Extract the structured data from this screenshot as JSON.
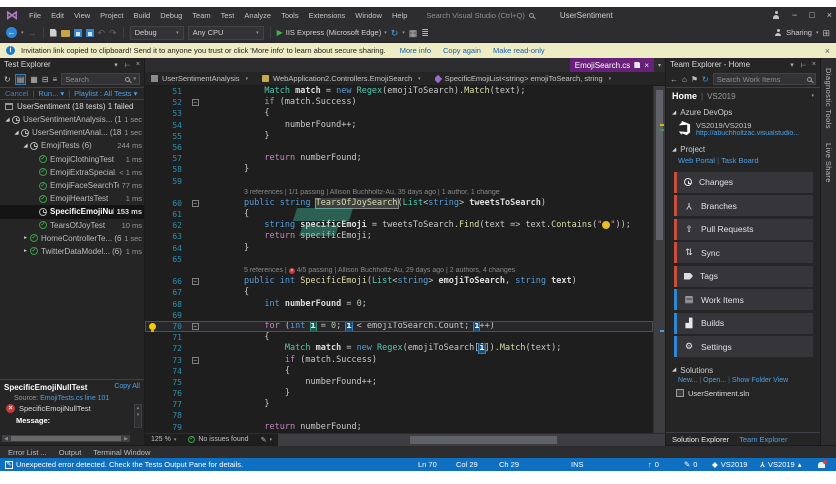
{
  "title_bar": {
    "menus": [
      "File",
      "Edit",
      "View",
      "Project",
      "Build",
      "Debug",
      "Team",
      "Test",
      "Analyze",
      "Tools",
      "Extensions",
      "Window",
      "Help"
    ],
    "search_placeholder": "Search Visual Studio (Ctrl+Q)",
    "title": "UserSentiment"
  },
  "toolbar": {
    "config": "Debug",
    "platform": "Any CPU",
    "run_target": "IIS Express (Microsoft Edge)",
    "sharing_label": "Sharing"
  },
  "infobar": {
    "message": "Invitation link copied to clipboard! Send it to anyone you trust or click 'More info' to learn about secure sharing.",
    "more_info": "More info",
    "copy_again": "Copy again",
    "make_read_only": "Make read-only"
  },
  "test_explorer": {
    "title": "Test Explorer",
    "search_placeholder": "Search",
    "cancel": "Cancel",
    "run": "Run...",
    "playlist": "Playlist : All Tests",
    "summary": "UserSentiment (18 tests) 1 failed",
    "tree": [
      {
        "indent": 0,
        "arrow": "exp",
        "icon": "clock",
        "label": "UserSentimentAnalysis... (10)",
        "time": "1 sec"
      },
      {
        "indent": 1,
        "arrow": "exp",
        "icon": "clock",
        "label": "UserSentimentAnal... (18)",
        "time": "1 sec"
      },
      {
        "indent": 2,
        "arrow": "exp",
        "icon": "clock",
        "label": "EmojiTests (6)",
        "time": "244 ms"
      },
      {
        "indent": 3,
        "icon": "pass",
        "label": "EmojiClothingTest",
        "time": "1 ms"
      },
      {
        "indent": 3,
        "icon": "pass",
        "label": "EmojiExtraSpecial...",
        "time": "< 1 ms"
      },
      {
        "indent": 3,
        "icon": "pass",
        "label": "EmojiFaceSearchTest",
        "time": "77 ms"
      },
      {
        "indent": 3,
        "icon": "pass",
        "label": "EmojiHeartsTest",
        "time": "1 ms"
      },
      {
        "indent": 3,
        "icon": "clock",
        "label": "SpecificEmojiNullT...",
        "time": "153 ms",
        "selected": true
      },
      {
        "indent": 3,
        "icon": "pass",
        "label": "TearsOfJoyTest",
        "time": "10 ms"
      },
      {
        "indent": 2,
        "arrow": "col",
        "icon": "pass",
        "label": "HomeControllerTe... (6)",
        "time": "1 sec"
      },
      {
        "indent": 2,
        "arrow": "col",
        "icon": "pass",
        "label": "TwitterDataModel... (6)",
        "time": "1 ms"
      }
    ],
    "details": {
      "title": "SpecificEmojiNullTest",
      "copy_all": "Copy All",
      "source_label": "Source:",
      "source_link": "EmojiTests.cs line 101",
      "result": "SpecificEmojiNullTest",
      "message_label": "Message:"
    }
  },
  "editor": {
    "tab": "EmojiSearch.cs",
    "nav": [
      "UserSentimentAnalysis",
      "WebApplication2.Controllers.EmojiSearch",
      "SpecificEmojiList<string> emojiToSearch, string"
    ],
    "zoom": "125 %",
    "issues": "No issues found",
    "lines": [
      {
        "n": 51,
        "t": [
          [
            "            "
          ],
          [
            "Match",
            "ty"
          ],
          [
            " "
          ],
          [
            "match",
            "v"
          ],
          [
            " = "
          ],
          [
            "new",
            "kw"
          ],
          [
            " "
          ],
          [
            "Regex",
            "ty"
          ],
          [
            "("
          ],
          [
            "emojiToSearch"
          ],
          [
            ")."
          ],
          [
            "Match",
            "m"
          ],
          [
            "("
          ],
          [
            "text"
          ],
          [
            ");"
          ]
        ]
      },
      {
        "n": 52,
        "fold": 1,
        "t": [
          [
            "            "
          ],
          [
            "if",
            "ctrl"
          ],
          [
            " ("
          ],
          [
            "match"
          ],
          [
            ".Success)"
          ]
        ]
      },
      {
        "n": 53,
        "t": [
          [
            "            {"
          ]
        ]
      },
      {
        "n": 54,
        "t": [
          [
            "                "
          ],
          [
            "numberFound"
          ],
          [
            "++;"
          ]
        ]
      },
      {
        "n": 55,
        "t": [
          [
            "            }"
          ]
        ]
      },
      {
        "n": 56,
        "t": []
      },
      {
        "n": 57,
        "t": [
          [
            "            "
          ],
          [
            "return",
            "ctrl"
          ],
          [
            " "
          ],
          [
            "numberFound"
          ],
          [
            ";"
          ]
        ]
      },
      {
        "n": 58,
        "t": [
          [
            "        }"
          ]
        ]
      },
      {
        "n": 59,
        "t": []
      },
      {
        "n": 60,
        "fold": 1,
        "lens": {
          "pre": "3 references | ",
          "post": "1/1 passing | Allison Buchholtz-Au, 35 days ago | 1 author, 1 change",
          "fail": false
        },
        "t": [
          [
            "        "
          ],
          [
            "public",
            "kw"
          ],
          [
            " "
          ],
          [
            "string",
            "kw"
          ],
          [
            " "
          ],
          [
            "TearsOfJoySearch",
            "mh"
          ],
          [
            "("
          ],
          [
            "List",
            "ty"
          ],
          [
            "<"
          ],
          [
            "string",
            "kw"
          ],
          [
            "> "
          ],
          [
            "tweetsToSearch",
            "v"
          ],
          [
            ")"
          ]
        ]
      },
      {
        "n": 61,
        "t": [
          [
            "        {"
          ]
        ]
      },
      {
        "n": 62,
        "t": [
          [
            "            "
          ],
          [
            "string",
            "kw"
          ],
          [
            " "
          ],
          [
            "specificEmoji",
            "v"
          ],
          [
            " = "
          ],
          [
            "tweetsToSearch"
          ],
          [
            "."
          ],
          [
            "Find",
            "m"
          ],
          [
            "("
          ],
          [
            "text"
          ],
          [
            " => "
          ],
          [
            "text"
          ],
          [
            "."
          ],
          [
            "Contains",
            "m"
          ],
          [
            "("
          ],
          [
            "\"",
            "s"
          ],
          [
            "😂",
            "emo"
          ],
          [
            "\"",
            "s"
          ],
          [
            "));"
          ]
        ]
      },
      {
        "n": 63,
        "t": [
          [
            "            "
          ],
          [
            "return",
            "ctrl"
          ],
          [
            " "
          ],
          [
            "specificEmoji"
          ],
          [
            ";"
          ]
        ]
      },
      {
        "n": 64,
        "t": [
          [
            "        }"
          ]
        ]
      },
      {
        "n": 65,
        "t": []
      },
      {
        "n": 66,
        "fold": 1,
        "lens": {
          "pre": "5 references | ",
          "post": "4/5 passing | Allison Buchholtz-Au, 29 days ago | 2 authors, 4 changes",
          "fail": true
        },
        "t": [
          [
            "        "
          ],
          [
            "public",
            "kw"
          ],
          [
            " "
          ],
          [
            "int",
            "kw"
          ],
          [
            " "
          ],
          [
            "SpecificEmoji",
            "m"
          ],
          [
            "("
          ],
          [
            "List",
            "ty"
          ],
          [
            "<"
          ],
          [
            "string",
            "kw"
          ],
          [
            "> "
          ],
          [
            "emojiToSearch",
            "v"
          ],
          [
            ", "
          ],
          [
            "string",
            "kw"
          ],
          [
            " "
          ],
          [
            "text",
            "v"
          ],
          [
            ")"
          ]
        ]
      },
      {
        "n": 67,
        "t": [
          [
            "        {"
          ]
        ]
      },
      {
        "n": 68,
        "t": [
          [
            "            "
          ],
          [
            "int",
            "kw"
          ],
          [
            " "
          ],
          [
            "numberFound",
            "v"
          ],
          [
            " = "
          ],
          [
            "0",
            "n"
          ],
          [
            ";"
          ]
        ]
      },
      {
        "n": 69,
        "t": []
      },
      {
        "n": 70,
        "fold": 1,
        "cur": true,
        "bulb": true,
        "t": [
          [
            "            "
          ],
          [
            "for",
            "ctrl"
          ],
          [
            " ("
          ],
          [
            "int",
            "kw"
          ],
          [
            " "
          ],
          [
            "i",
            "iD"
          ],
          [
            " = "
          ],
          [
            "0",
            "n"
          ],
          [
            "; "
          ],
          [
            "i",
            "iS"
          ],
          [
            " < "
          ],
          [
            "emojiToSearch"
          ],
          [
            ".Count; "
          ],
          [
            "i",
            "iS"
          ],
          [
            "++)"
          ]
        ]
      },
      {
        "n": 71,
        "t": [
          [
            "            {"
          ]
        ]
      },
      {
        "n": 72,
        "t": [
          [
            "                "
          ],
          [
            "Match",
            "ty"
          ],
          [
            " "
          ],
          [
            "match",
            "v"
          ],
          [
            " = "
          ],
          [
            "new",
            "kw"
          ],
          [
            " "
          ],
          [
            "Regex",
            "ty"
          ],
          [
            "("
          ],
          [
            "emojiToSearch"
          ],
          [
            "["
          ],
          [
            "i",
            "iS"
          ],
          [
            "])."
          ],
          [
            "Match",
            "m"
          ],
          [
            "("
          ],
          [
            "text"
          ],
          [
            ");"
          ]
        ]
      },
      {
        "n": 73,
        "fold": 1,
        "t": [
          [
            "                "
          ],
          [
            "if",
            "ctrl"
          ],
          [
            " ("
          ],
          [
            "match"
          ],
          [
            ".Success)"
          ]
        ]
      },
      {
        "n": 74,
        "t": [
          [
            "                {"
          ]
        ]
      },
      {
        "n": 75,
        "t": [
          [
            "                    "
          ],
          [
            "numberFound"
          ],
          [
            "++;"
          ]
        ]
      },
      {
        "n": 76,
        "t": [
          [
            "                }"
          ]
        ]
      },
      {
        "n": 77,
        "t": [
          [
            "            }"
          ]
        ]
      },
      {
        "n": 78,
        "t": []
      },
      {
        "n": 79,
        "t": [
          [
            "            "
          ],
          [
            "return",
            "ctrl"
          ],
          [
            " "
          ],
          [
            "numberFound"
          ],
          [
            ";"
          ]
        ]
      }
    ]
  },
  "team_explorer": {
    "title": "Team Explorer - Home",
    "search_placeholder": "Search Work Items",
    "home": "Home",
    "context": "VS2019",
    "section_devops": "Azure DevOps",
    "account": "VS2019/VS2019",
    "account_url": "http://abuchholtzac.visualstudio...",
    "section_project": "Project",
    "web_portal": "Web Portal",
    "task_board": "Task Board",
    "nav_items": [
      {
        "label": "Changes",
        "icon": "clock",
        "bar": "red"
      },
      {
        "label": "Branches",
        "icon": "branch",
        "bar": "red"
      },
      {
        "label": "Pull Requests",
        "icon": "pr",
        "bar": "red"
      },
      {
        "label": "Sync",
        "icon": "sync",
        "bar": "red"
      },
      {
        "label": "Tags",
        "icon": "tag",
        "bar": "red"
      },
      {
        "label": "Work Items",
        "icon": "work",
        "bar": "blue"
      },
      {
        "label": "Builds",
        "icon": "build",
        "bar": "blue"
      },
      {
        "label": "Settings",
        "icon": "gear",
        "bar": "blue"
      }
    ],
    "section_solutions": "Solutions",
    "new_link": "New...",
    "open_link": "Open...",
    "folder_link": "Show Folder View",
    "solution": "UserSentiment.sln",
    "tabs": [
      "Solution Explorer",
      "Team Explorer"
    ]
  },
  "right_strip": {
    "tabs": [
      "Diagnostic Tools",
      "Live Share"
    ]
  },
  "bottom_tabs": [
    "Error List ...",
    "Output",
    "Terminal Window"
  ],
  "status_bar": {
    "message": "Unexpected error detected. Check the Tests Output Pane for details.",
    "ln": "Ln 70",
    "col": "Col 29",
    "ch": "Ch 29",
    "mode": "INS",
    "pushes": "0",
    "edits": "0",
    "repo": "VS2019",
    "branch": "VS2019"
  },
  "colors": {
    "accent": "#0f70c2",
    "tab_active": "#68217a",
    "infobar": "#eeecc4",
    "git_bar": "#c94f3d",
    "vsts_bar": "#2f86d2"
  }
}
